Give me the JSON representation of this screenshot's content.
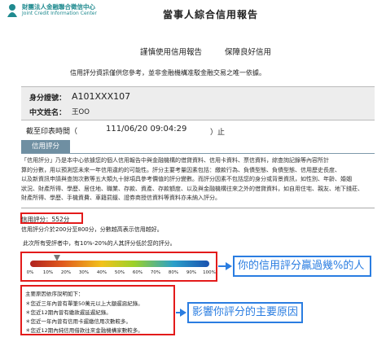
{
  "header": {
    "org_cn": "財團法人金融聯合徵信中心",
    "org_en": "Joint Credit Information Center",
    "title": "當事人綜合信用報告",
    "brand_color": "#1f8a8f"
  },
  "mottos": [
    "謹慎使用信用報告",
    "保障良好信用"
  ],
  "notice": "信用評分資訊僅供您參考，並非金融機構准駁金融交易之唯一依據。",
  "identity": {
    "id_label": "身分證號：",
    "id_value": "A101XXX107",
    "name_label": "中文姓名：",
    "name_value": "王OO"
  },
  "deadline": {
    "label": "截至印表時間（",
    "value": "111/06/20 09:04:29",
    "suffix": "）止"
  },
  "tab_label": "信用評分",
  "description": [
    "「信用評分」乃是本中心依據您的個人信用報告中與金融機構的借貸資料、信用卡資料、票信資料，綜查詢記錄等內容所計",
    "算的分數，用以預測您未來一年信用違約的可能性。評分主要考量因素包括：繳款行為、負債型態、負債型態、信用歷史長度、",
    "以及新資訊申請與查詢次數等五大類九十餘項具參考價值的評分變數。而評分因素不包括您的身分或背景資訊，如性別、年齡、婚姻",
    "狀況、財產所得、學歷、居住地、職業、存款、資產、存款額度、以及與金融機構往來之外的借貸資料，如自用住宅、親友、地下錢莊、",
    "財產所得、學歷、手機資費、車籍罰鍰、證券商授信資料等資料亦未納入評分。"
  ],
  "score": {
    "label": "信用評分：",
    "value": "552分",
    "range_note": "信用評分介於200分至800分，分數越高表示信用越好。",
    "percentile_note": "此次所有受評者中，有10%-20%的人其評分低於您的評分。",
    "percentile_value": 0.15,
    "tick_labels": [
      "0%",
      "10%",
      "20%",
      "30%",
      "40%",
      "50%",
      "60%",
      "70%",
      "80%",
      "90%",
      "100%"
    ],
    "callout": "你的信用評分贏過幾%的人"
  },
  "reasons": {
    "title": "主要原因依序說明如下：",
    "items": [
      "＊您近三年內曾有單筆50萬元以上大額遲惡紀錄。",
      "＊您近12期內曾有繳款遲延遲紀錄。",
      "＊您近一年內曾有信用卡遲繳信用次數較多。",
      "＊您近12期內純信用借款往來金融機構家數較多。"
    ],
    "callout": "影響你評分的主要原因"
  },
  "colors": {
    "highlight_red": "#e31b1b",
    "callout_blue": "#2a7de1",
    "tab_bg": "#6f8fa2"
  }
}
